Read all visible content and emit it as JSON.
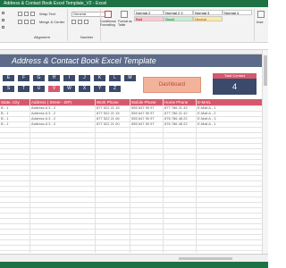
{
  "window": {
    "title": "Address & Contact Book Excel Template_V2 - Excel"
  },
  "ribbon": {
    "wrap_text": "Wrap Text",
    "merge_center": "Merge & Center",
    "number_format": "General",
    "alignment_group": "Alignment",
    "number_group": "Number",
    "conditional_formatting": "Conditional Formatting",
    "format_as_table": "Format as Table",
    "styles": [
      "Normal 2",
      "Normal 2 2",
      "Normal 3",
      "Normal 4",
      "Bad",
      "Good",
      "Neutral"
    ],
    "insert": "Inse"
  },
  "sheet": {
    "banner_title": "Address & Contact Book Excel Template",
    "letters_row1": [
      "E",
      "F",
      "G",
      "H",
      "I",
      "J",
      "K",
      "L",
      "M"
    ],
    "letters_row2": [
      "S",
      "T",
      "U",
      "V",
      "W",
      "X",
      "Y",
      "Z"
    ],
    "active_letter": "V",
    "dashboard_label": "Dashboard",
    "total_label": "Total Contact",
    "total_value": "4",
    "headers": [
      "State, City",
      "Address ( Street - ZIP)",
      "Work Phone",
      "Mobile Phone",
      "Home Phone",
      "E-MAIL"
    ],
    "rows": [
      [
        "B - 1",
        "Address A 3 - 2",
        "877 522 21 15",
        "555 647 90 97",
        "877 786 21 43",
        "E-Mail A - 1"
      ],
      [
        "B - 1",
        "Address A 3 - 2",
        "877 522 21 15",
        "555 647 90 97",
        "877 786 21 42",
        "E-Mail A - 2"
      ],
      [
        "B - 1",
        "Address A 3 - 2",
        "877 522 21 06",
        "555 647 90 97",
        "876 786 48 22",
        "E-Mail A - 3"
      ],
      [
        "B - 1",
        "Address A 3 - 2",
        "877 522 21 00",
        "555 647 90 97",
        "876 786 48 22",
        "E-Mail A - 1"
      ]
    ]
  },
  "colors": {
    "excel_green": "#1e7145",
    "banner": "#5d6b8a",
    "navy": "#3b4a6b",
    "accent": "#d6586d",
    "dashboard": "#f2b39a"
  }
}
